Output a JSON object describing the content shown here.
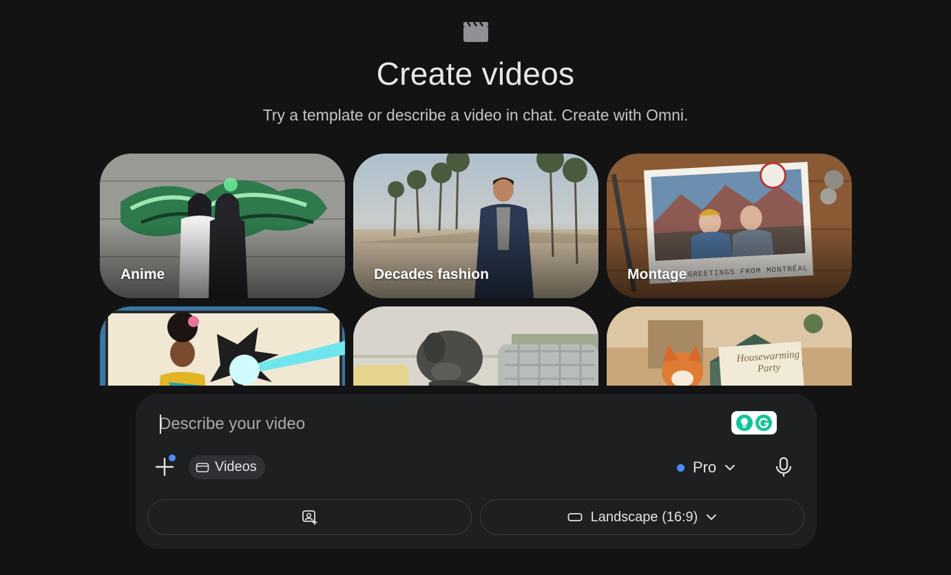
{
  "header": {
    "icon": "clapperboard-icon",
    "title": "Create videos",
    "subtitle": "Try a template or describe a video in chat. Create with Omni."
  },
  "templates": [
    {
      "label": "Anime"
    },
    {
      "label": "Decades fashion"
    },
    {
      "label": "Montage",
      "overlay_text": "GREETINGS FROM MONTRÉAL"
    },
    {
      "label": ""
    },
    {
      "label": ""
    },
    {
      "label": "",
      "overlay_text": "Housewarming Party"
    }
  ],
  "composer": {
    "placeholder": "Describe your video",
    "add_icon": "plus-icon",
    "tool_chip": {
      "icon": "video-icon",
      "label": "Videos"
    },
    "model": {
      "label": "Pro",
      "status_color": "#4b8df8"
    },
    "mic_icon": "microphone-icon",
    "image_button_icon": "add-image-icon",
    "aspect": {
      "icon": "landscape-icon",
      "label": "Landscape (16:9)"
    }
  },
  "colors": {
    "background": "#131314",
    "composer": "#1e1f20",
    "accent": "#4b8df8"
  }
}
